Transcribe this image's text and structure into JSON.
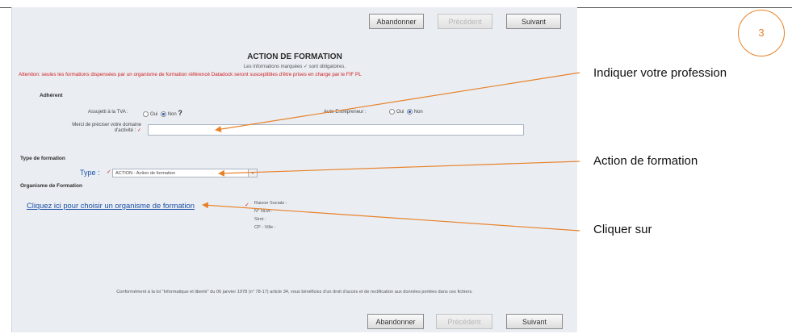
{
  "toolbar": {
    "abandon": "Abandonner",
    "previous": "Précédent",
    "next": "Suivant"
  },
  "form": {
    "title": "ACTION DE FORMATION",
    "subtitle": "Les informations marquées ✓ sont obligatoires.",
    "warning": "Attention: seules les formations dispensées par un organisme de formation référencé Datadock seront susceptibles d'être prises en charge par le FIF PL",
    "section_adherent": "Adhérent",
    "tva_label": "Assujetti à la TVA :",
    "auto_label": "Auto-Entrepreneur :",
    "oui": "Oui",
    "non": "Non",
    "profession_label_1": "Merci de préciser votre domaine",
    "profession_label_2": "d'activité :",
    "profession_value": "",
    "section_type": "Type de formation",
    "type_label": "Type :",
    "type_value": "ACTION - Action de formation",
    "section_organisme": "Organisme de Formation",
    "organisme_link": "Cliquez ici pour choisir un organisme de formation",
    "organisme_info": [
      "Raison Sociale :",
      "N° NDA :",
      "Siret :",
      "CP - Ville :"
    ],
    "footer": "Conformément à la loi \"Informatique et liberté\" du 06 janvier 1978 (n° 78-17) article 34, vous bénéficiez d'un droit d'accès et de rectification aux données portées dans ces fichiers."
  },
  "annotations": {
    "step": "3",
    "profession": "Indiquer votre profession",
    "action": "Action de formation",
    "click": "Cliquer sur"
  },
  "colors": {
    "accent": "#e8822a",
    "link": "#1d4fa6",
    "warning": "#d02020",
    "panel": "#eaeef3"
  }
}
